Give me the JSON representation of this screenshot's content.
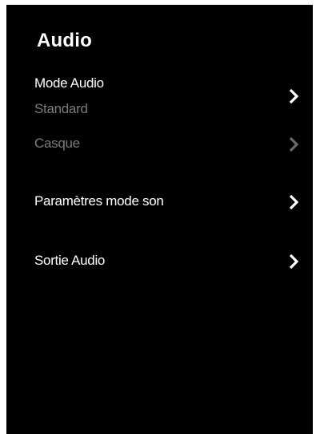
{
  "panel": {
    "title": "Audio"
  },
  "menu": {
    "items": [
      {
        "label": "Mode Audio",
        "value": "Standard",
        "enabled": true,
        "icon": "chevron-right-icon"
      },
      {
        "label": "Casque",
        "enabled": false,
        "icon": "chevron-right-icon"
      },
      {
        "label": "Paramètres mode son",
        "enabled": true,
        "icon": "chevron-right-icon"
      },
      {
        "label": "Sortie Audio",
        "enabled": true,
        "icon": "chevron-right-icon"
      }
    ]
  },
  "colors": {
    "background": "#000000",
    "text": "#ffffff",
    "dimmed": "#7a7a7a"
  }
}
